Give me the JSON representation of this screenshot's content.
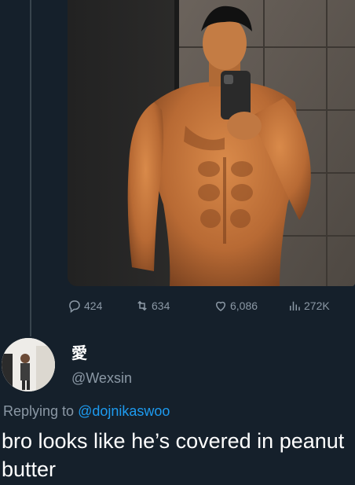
{
  "tweet": {
    "stats": {
      "replies": "424",
      "retweets": "634",
      "likes": "6,086",
      "views": "272K"
    },
    "media_icon": "photo"
  },
  "reply": {
    "display_name": "愛",
    "handle": "@Wexsin",
    "replying_prefix": "Replying to",
    "replying_to": "@dojnikaswoo",
    "text": "bro looks like he’s covered in peanut butter"
  },
  "colors": {
    "background": "#15202b",
    "muted": "#8b98a5",
    "link": "#1d9bf0",
    "thread_line": "#38444d"
  },
  "icons": [
    "reply-icon",
    "retweet-icon",
    "like-icon",
    "views-icon",
    "avatar"
  ]
}
